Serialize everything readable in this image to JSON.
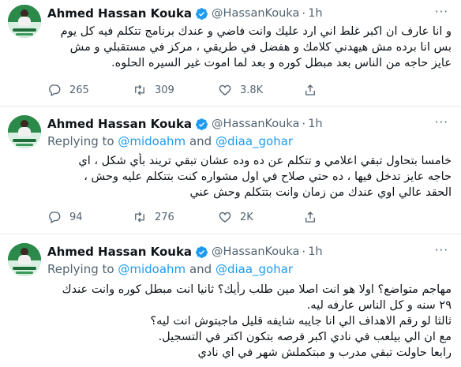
{
  "tweets": [
    {
      "name": "Ahmed Hassan Kouka",
      "handle": "@HassanKouka",
      "dot": "·",
      "time": "1h",
      "more": "···",
      "reply_prefix": "",
      "reply_to_1": "",
      "reply_and": "",
      "reply_to_2": "",
      "lines": [
        "و انا عارف ان اكبر غلط اني ارد عليك وانت فاضي و عندك برنامج تتكلم فيه كل يوم",
        "بس انا برده مش هيهدني كلامك و هفضل في طريقي ، مركز في مستقبلي و مش",
        "عايز حاجه من الناس بعد مبطل كوره و بعد لما اموت غير السيره الحلوه."
      ],
      "replies": "265",
      "retweets": "309",
      "likes": "3.8K"
    },
    {
      "name": "Ahmed Hassan Kouka",
      "handle": "@HassanKouka",
      "dot": "·",
      "time": "1h",
      "more": "···",
      "reply_prefix": "Replying to",
      "reply_to_1": "@midoahm",
      "reply_and": "and",
      "reply_to_2": "@diaa_gohar",
      "lines": [
        "خامسا بتحاول تبقي اعلامي و تتكلم عن ده وده عشان تبقي تريند بأي شكل ، اي",
        "حاجه عايز تدخل فيها ، ده حتي صلاح في اول مشواره كنت بتتكلم عليه وحش ،",
        "الحقد عالي اوي عندك من زمان وانت بتتكلم وحش عني"
      ],
      "replies": "94",
      "retweets": "276",
      "likes": "2K"
    },
    {
      "name": "Ahmed Hassan Kouka",
      "handle": "@HassanKouka",
      "dot": "·",
      "time": "1h",
      "more": "···",
      "reply_prefix": "Replying to",
      "reply_to_1": "@midoahm",
      "reply_and": "and",
      "reply_to_2": "@diaa_gohar",
      "lines": [
        "مهاجم متواضع؟ اولا هو انت اصلا مين طلب رأيك؟ ثانيا انت مبطل كوره وانت عندك",
        "٢٩ سنه و كل الناس عارفه ليه.",
        "ثالثا لو رقم الاهداف الي انا جايبه شايفه قليل ماجبتوش انت ليه؟",
        "مع ان الي بيلعب في نادي اكبر فرصه بتكون اكتر في التسجيل.",
        "رابعا حاولت تبقي مدرب و مبتكملش شهر في اي نادي"
      ],
      "replies": "",
      "retweets": "",
      "likes": ""
    }
  ],
  "colors": {
    "accent": "#1d9bf0",
    "muted": "#536471",
    "divider": "#e6ecf0"
  },
  "icons": [
    "verified-badge-icon",
    "reply-icon",
    "retweet-icon",
    "like-icon",
    "share-icon",
    "more-icon"
  ]
}
